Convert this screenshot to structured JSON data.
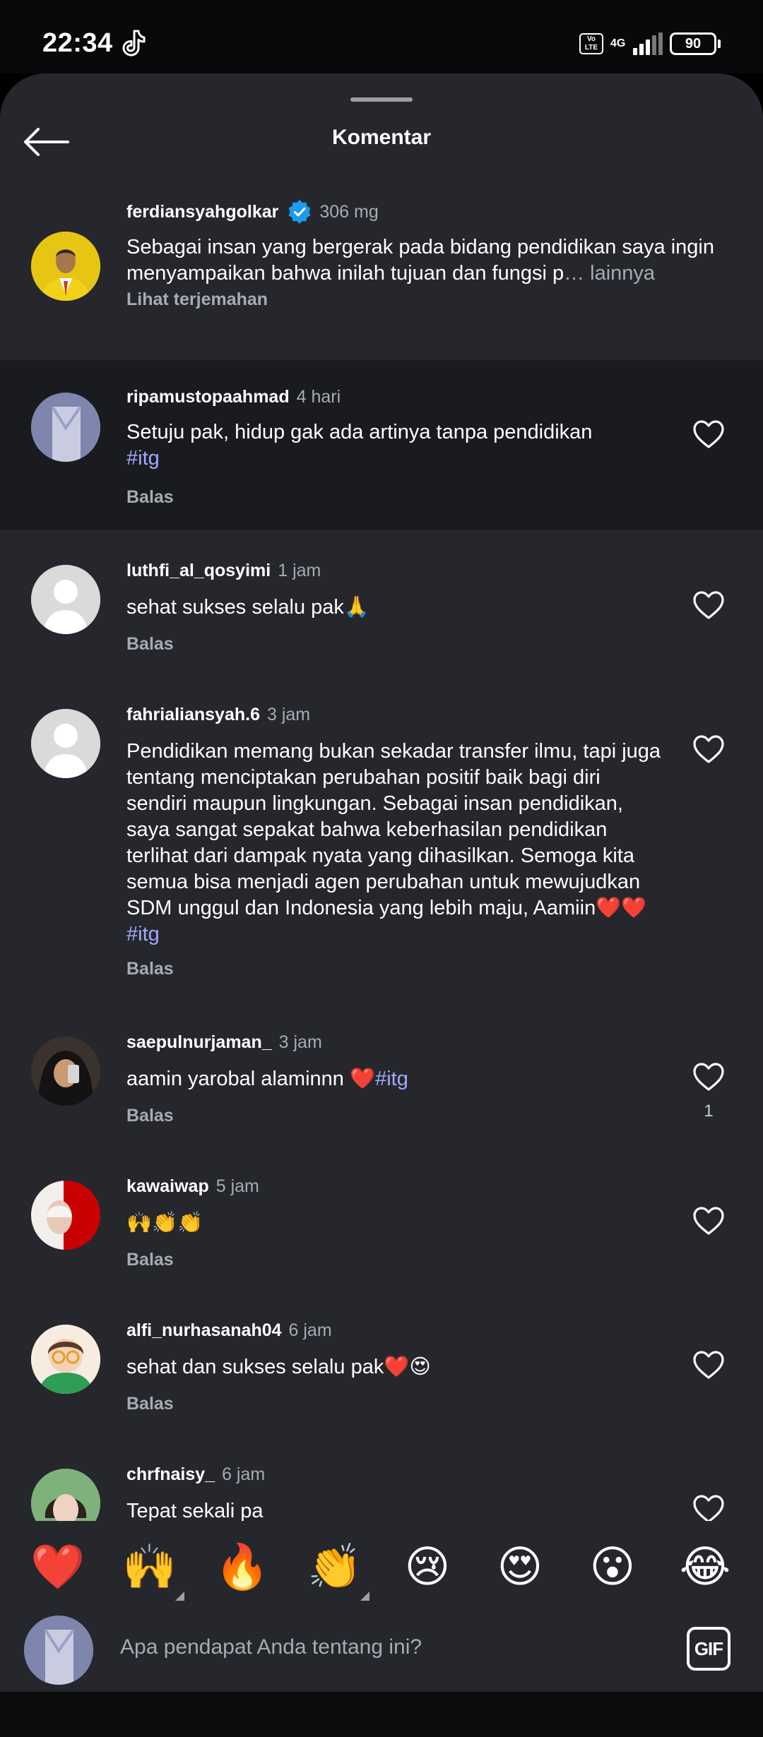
{
  "status_bar": {
    "time": "22:34",
    "network": "4G",
    "volte": "Vo LTE",
    "battery": "90"
  },
  "header": {
    "title": "Komentar"
  },
  "caption": {
    "username": "ferdiansyahgolkar",
    "time": "306 mg",
    "text": "Sebagai insan yang bergerak pada bidang pendidikan saya ingin menyampaikan bahwa inilah tujuan dan fungsi p",
    "more": "… lainnya",
    "translate": "Lihat terjemahan"
  },
  "comments": [
    {
      "username": "ripamustopaahmad",
      "time": "4 hari",
      "text": "Setuju pak, hidup gak ada artinya tanpa pendidikan",
      "hashtag": "#itg",
      "reply": "Balas"
    },
    {
      "username": "luthfi_al_qosyimi",
      "time": "1 jam",
      "text": "sehat sukses selalu pak🙏",
      "reply": "Balas"
    },
    {
      "username": "fahrialiansyah.6",
      "time": "3 jam",
      "text": "Pendidikan memang bukan sekadar transfer ilmu, tapi juga tentang menciptakan perubahan positif baik bagi diri sendiri maupun lingkungan. Sebagai insan pendidikan, saya sangat sepakat bahwa keberhasilan pendidikan terlihat dari dampak nyata yang dihasilkan. Semoga kita semua bisa menjadi agen perubahan untuk mewujudkan SDM unggul dan Indonesia yang lebih maju, Aamiin❤️❤️ ",
      "hashtag": "#itg",
      "reply": "Balas"
    },
    {
      "username": "saepulnurjaman_",
      "time": "3 jam",
      "text": "aamin yarobal alaminnn ❤️",
      "hashtag": "#itg",
      "reply": "Balas",
      "likes": "1"
    },
    {
      "username": "kawaiwap",
      "time": "5 jam",
      "text": "🙌👏👏",
      "reply": "Balas"
    },
    {
      "username": "alfi_nurhasanah04",
      "time": "6 jam",
      "text": "sehat dan sukses selalu pak❤️😍",
      "reply": "Balas"
    },
    {
      "username": "chrfnaisy_",
      "time": "6 jam",
      "text": "Tepat sekali pa"
    }
  ],
  "emoji_bar": [
    "❤️",
    "🙌",
    "🔥",
    "👏",
    "😢",
    "😍",
    "😮",
    "😂"
  ],
  "composer": {
    "placeholder": "Apa pendapat Anda tentang ini?",
    "gif_label": "GIF"
  },
  "colors": {
    "sheet": "#25272c",
    "highlight": "#1a1b1f",
    "hashtag": "#a3a8ff",
    "verified": "#1d9bf0",
    "muted": "#a8abb2"
  }
}
